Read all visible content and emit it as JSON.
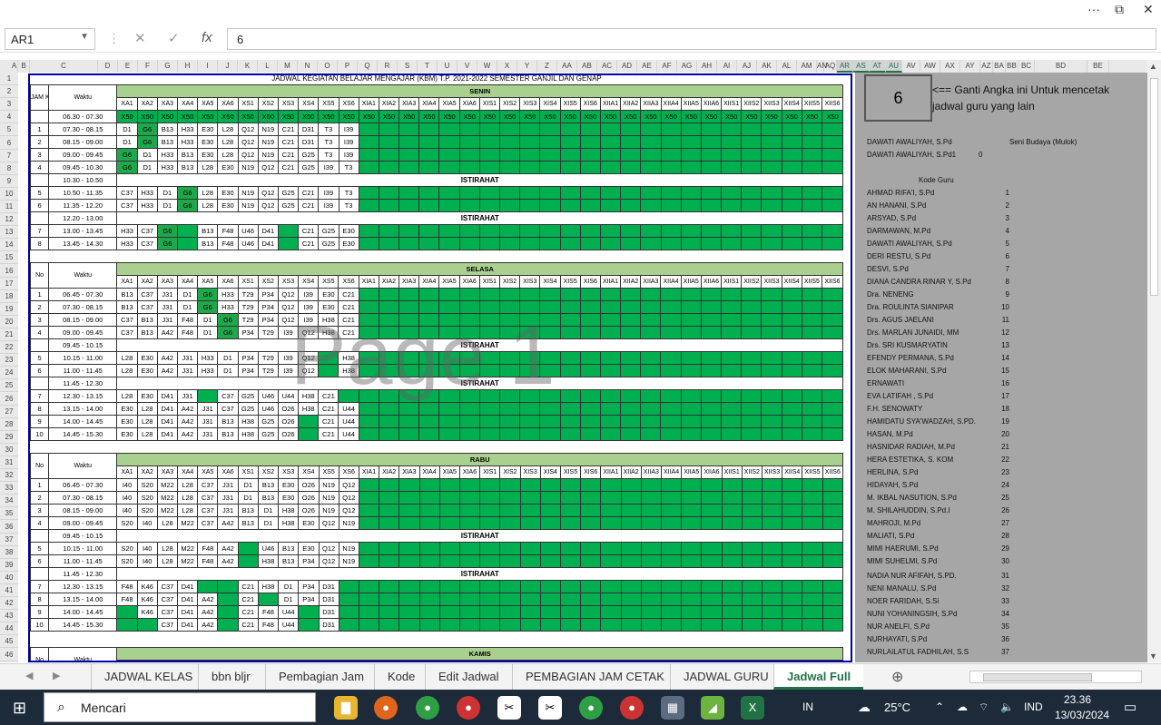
{
  "window": {
    "ribbon_dots": "···",
    "restore": "⧉",
    "close": "✕"
  },
  "formula_bar": {
    "name_box": "AR1",
    "cancel": "✕",
    "enter": "✓",
    "fx": "fx",
    "value": "6"
  },
  "columns": [
    "A",
    "B",
    "C",
    "D",
    "E",
    "F",
    "G",
    "H",
    "I",
    "J",
    "K",
    "L",
    "M",
    "N",
    "O",
    "P",
    "Q",
    "R",
    "S",
    "T",
    "U",
    "V",
    "W",
    "X",
    "Y",
    "Z",
    "AA",
    "AB",
    "AC",
    "AD",
    "AE",
    "AF",
    "AG",
    "AH",
    "AI",
    "AJ",
    "AK",
    "AL",
    "AM",
    "AN",
    "AQ",
    "AR",
    "AS",
    "AT",
    "AU",
    "AV",
    "AW",
    "AX",
    "AY",
    "AZ",
    "BA",
    "BB",
    "BC",
    "BD",
    "BE"
  ],
  "selected_columns": [
    "AR",
    "AS",
    "AT",
    "AU"
  ],
  "rows": [
    "1",
    "2",
    "3",
    "4",
    "5",
    "6",
    "7",
    "8",
    "9",
    "10",
    "11",
    "12",
    "13",
    "14",
    "15",
    "16",
    "17",
    "18",
    "19",
    "20",
    "21",
    "22",
    "23",
    "24",
    "25",
    "26",
    "27",
    "28",
    "29",
    "30",
    "31",
    "32",
    "33",
    "34",
    "35",
    "36",
    "37",
    "38",
    "39",
    "40",
    "41",
    "42",
    "43",
    "44",
    "45",
    "46"
  ],
  "sheet_title": "JADWAL KEGIATAN BELAJAR MENGAJAR (KBM) T.P. 2021-2022 SEMESTER GANJIL DAN GENAP",
  "hdr": {
    "jam_ke": "JAM KE",
    "no": "No",
    "waktu": "Waktu"
  },
  "class_cols": [
    "XA1",
    "XA2",
    "XA3",
    "XA4",
    "XA5",
    "XA6",
    "XS1",
    "XS2",
    "XS3",
    "XS4",
    "XS5",
    "XS6",
    "XIA1",
    "XIA2",
    "XIA3",
    "XIA4",
    "XIA5",
    "XIA6",
    "XIS1",
    "XIS2",
    "XIS3",
    "XIS4",
    "XIS5",
    "XIS6",
    "XIIA1",
    "XIIA2",
    "XIIA3",
    "XIIA4",
    "XIIA5",
    "XIIA6",
    "XIIS1",
    "XIIS2",
    "XIIS3",
    "XIIS4",
    "XIIS5",
    "XIIS6"
  ],
  "days": {
    "senin": {
      "name": "SENIN",
      "rows": [
        {
          "no": "",
          "time": "06.30 - 07.30",
          "cells": [
            "X50",
            "X50",
            "X50",
            "X50",
            "X50",
            "X50",
            "X50",
            "X50",
            "X50",
            "X50",
            "X50",
            "X50",
            "X50",
            "X50",
            "X50",
            "X50",
            "X50",
            "X50",
            "X50",
            "X50",
            "X50",
            "X50",
            "X50",
            "X50",
            "X50",
            "X50",
            "X50",
            "X50",
            "X50",
            "X50",
            "X50",
            "X50",
            "X50",
            "X50",
            "X50",
            "X50"
          ],
          "allgreen": true
        },
        {
          "no": "1",
          "time": "07.30 - 08.15",
          "cells": [
            "D1",
            "G6",
            "B13",
            "H33",
            "E30",
            "L28",
            "Q12",
            "N19",
            "C21",
            "D31",
            "T3",
            "I39"
          ]
        },
        {
          "no": "2",
          "time": "08.15 - 09.00",
          "cells": [
            "D1",
            "G6",
            "B13",
            "H33",
            "E30",
            "L28",
            "Q12",
            "N19",
            "C21",
            "D31",
            "T3",
            "I39"
          ]
        },
        {
          "no": "3",
          "time": "09.00 - 09.45",
          "cells": [
            "G6",
            "D1",
            "H33",
            "B13",
            "E30",
            "L28",
            "Q12",
            "N19",
            "C21",
            "G25",
            "T3",
            "I39"
          ]
        },
        {
          "no": "4",
          "time": "09.45 - 10.30",
          "cells": [
            "G6",
            "D1",
            "H33",
            "B13",
            "L28",
            "E30",
            "N19",
            "Q12",
            "C21",
            "G25",
            "I39",
            "T3"
          ]
        },
        {
          "ist": "ISTIRAHAT",
          "time": "10.30 - 10.50"
        },
        {
          "no": "5",
          "time": "10.50 - 11.35",
          "cells": [
            "C37",
            "H33",
            "D1",
            "G6",
            "L28",
            "E30",
            "N19",
            "Q12",
            "G25",
            "C21",
            "I39",
            "T3"
          ]
        },
        {
          "no": "6",
          "time": "11.35 - 12.20",
          "cells": [
            "C37",
            "H33",
            "D1",
            "G6",
            "L28",
            "E30",
            "N19",
            "Q12",
            "G25",
            "C21",
            "I39",
            "T3"
          ]
        },
        {
          "ist": "ISTIRAHAT",
          "time": "12.20 - 13.00"
        },
        {
          "no": "7",
          "time": "13.00 - 13.45",
          "cells": [
            "H33",
            "C37",
            "G6",
            "",
            "B13",
            "F48",
            "U46",
            "D41",
            "",
            "C21",
            "G25",
            "E30"
          ]
        },
        {
          "no": "8",
          "time": "13.45 - 14.30",
          "cells": [
            "H33",
            "C37",
            "G6",
            "",
            "B13",
            "F48",
            "U46",
            "D41",
            "",
            "C21",
            "G25",
            "E30"
          ]
        }
      ]
    },
    "selasa": {
      "name": "SELASA",
      "rows": [
        {
          "no": "1",
          "time": "06.45 - 07.30",
          "cells": [
            "B13",
            "C37",
            "J31",
            "D1",
            "G6",
            "H33",
            "T29",
            "P34",
            "Q12",
            "I39",
            "E30",
            "C21"
          ]
        },
        {
          "no": "2",
          "time": "07.30 - 08.15",
          "cells": [
            "B13",
            "C37",
            "J31",
            "D1",
            "G6",
            "H33",
            "T29",
            "P34",
            "Q12",
            "I39",
            "E30",
            "C21"
          ]
        },
        {
          "no": "3",
          "time": "08.15 - 09.00",
          "cells": [
            "C37",
            "B13",
            "J31",
            "F48",
            "D1",
            "G6",
            "T29",
            "P34",
            "Q12",
            "I39",
            "H38",
            "C21"
          ]
        },
        {
          "no": "4",
          "time": "09.00 - 09.45",
          "cells": [
            "C37",
            "B13",
            "A42",
            "F48",
            "D1",
            "G6",
            "P34",
            "T29",
            "I39",
            "Q12",
            "H38",
            "C21"
          ]
        },
        {
          "ist": "ISTIRAHAT",
          "time": "09.45 - 10.15"
        },
        {
          "no": "5",
          "time": "10.15 - 11.00",
          "cells": [
            "L28",
            "E30",
            "A42",
            "J31",
            "H33",
            "D1",
            "P34",
            "T29",
            "I39",
            "Q12",
            "",
            "H38"
          ]
        },
        {
          "no": "6",
          "time": "11.00 - 11.45",
          "cells": [
            "L28",
            "E30",
            "A42",
            "J31",
            "H33",
            "D1",
            "P34",
            "T29",
            "I39",
            "Q12",
            "",
            "H38"
          ]
        },
        {
          "ist": "ISTIRAHAT",
          "time": "11.45 - 12.30"
        },
        {
          "no": "7",
          "time": "12.30 - 13.15",
          "cells": [
            "L28",
            "E30",
            "D41",
            "J31",
            "",
            "C37",
            "G25",
            "U46",
            "U44",
            "H38",
            "C21",
            ""
          ]
        },
        {
          "no": "8",
          "time": "13.15 - 14.00",
          "cells": [
            "E30",
            "L28",
            "D41",
            "A42",
            "J31",
            "C37",
            "G25",
            "U46",
            "O26",
            "H38",
            "C21",
            "U44"
          ]
        },
        {
          "no": "9",
          "time": "14.00 - 14.45",
          "cells": [
            "E30",
            "L28",
            "D41",
            "A42",
            "J31",
            "B13",
            "H38",
            "G25",
            "O26",
            "",
            "C21",
            "U44"
          ]
        },
        {
          "no": "10",
          "time": "14.45 - 15.30",
          "cells": [
            "E30",
            "L28",
            "D41",
            "A42",
            "J31",
            "B13",
            "H38",
            "G25",
            "O26",
            "",
            "C21",
            "U44"
          ]
        }
      ]
    },
    "rabu": {
      "name": "RABU",
      "rows": [
        {
          "no": "1",
          "time": "06.45 - 07.30",
          "cells": [
            "I40",
            "S20",
            "M22",
            "L28",
            "C37",
            "J31",
            "D1",
            "B13",
            "E30",
            "O26",
            "N19",
            "Q12"
          ]
        },
        {
          "no": "2",
          "time": "07.30 - 08.15",
          "cells": [
            "I40",
            "S20",
            "M22",
            "L28",
            "C37",
            "J31",
            "D1",
            "B13",
            "E30",
            "O26",
            "N19",
            "Q12"
          ]
        },
        {
          "no": "3",
          "time": "08.15 - 09.00",
          "cells": [
            "I40",
            "S20",
            "M22",
            "L28",
            "C37",
            "J31",
            "B13",
            "D1",
            "H38",
            "O26",
            "N19",
            "Q12"
          ]
        },
        {
          "no": "4",
          "time": "09.00 - 09.45",
          "cells": [
            "S20",
            "I40",
            "L28",
            "M22",
            "C37",
            "A42",
            "B13",
            "D1",
            "H38",
            "E30",
            "Q12",
            "N19"
          ]
        },
        {
          "ist": "ISTIRAHAT",
          "time": "09.45 - 10.15"
        },
        {
          "no": "5",
          "time": "10.15 - 11.00",
          "cells": [
            "S20",
            "I40",
            "L28",
            "M22",
            "F48",
            "A42",
            "",
            "U46",
            "B13",
            "E30",
            "Q12",
            "N19"
          ]
        },
        {
          "no": "6",
          "time": "11.00 - 11.45",
          "cells": [
            "S20",
            "I40",
            "L28",
            "M22",
            "F48",
            "A42",
            "",
            "H38",
            "B13",
            "P34",
            "Q12",
            "N19"
          ]
        },
        {
          "ist": "ISTIRAHAT",
          "time": "11.45 - 12.30"
        },
        {
          "no": "7",
          "time": "12.30 - 13.15",
          "cells": [
            "F48",
            "K46",
            "C37",
            "D41",
            "",
            "",
            "C21",
            "H38",
            "D1",
            "P34",
            "D31",
            ""
          ]
        },
        {
          "no": "8",
          "time": "13.15 - 14.00",
          "cells": [
            "F48",
            "K46",
            "C37",
            "D41",
            "A42",
            "",
            "C21",
            "",
            "D1",
            "P34",
            "D31",
            ""
          ]
        },
        {
          "no": "9",
          "time": "14.00 - 14.45",
          "cells": [
            "",
            "K46",
            "C37",
            "D41",
            "A42",
            "",
            "C21",
            "F48",
            "U44",
            "",
            "D31",
            ""
          ]
        },
        {
          "no": "10",
          "time": "14.45 - 15.30",
          "cells": [
            "",
            "",
            "C37",
            "D41",
            "A42",
            "",
            "C21",
            "F48",
            "U44",
            "",
            "D31",
            ""
          ]
        }
      ]
    },
    "kamis": {
      "name": "KAMIS"
    }
  },
  "watermark": "Page 1",
  "right_panel": {
    "value": "6",
    "note": "<== Ganti Angka ini Untuk mencetak jadwal guru yang lain",
    "teacher_line1": "DAWATI AWALIYAH, S.Pd",
    "teacher_subject": "Seni Budaya (Mulok)",
    "teacher_line2": "DAWATI AWALIYAH, S.Pd1",
    "teacher_zero": "0",
    "kode_guru": "Kode Guru",
    "teachers": [
      [
        "AHMAD RIFA'I, S.Pd",
        "1"
      ],
      [
        "AN HANANI, S.Pd",
        "2"
      ],
      [
        "ARSYAD, S.Pd",
        "3"
      ],
      [
        "DARMAWAN, M.Pd",
        "4"
      ],
      [
        "DAWATI AWALIYAH, S.Pd",
        "5"
      ],
      [
        "DERI RESTU, S.Pd",
        "6"
      ],
      [
        "DESVI, S.Pd",
        "7"
      ],
      [
        "DIANA CANDRA RINAR Y, S.Pd",
        "8"
      ],
      [
        "Dra. NENENG",
        "9"
      ],
      [
        "Dra. ROULINTA SIANIPAR",
        "10"
      ],
      [
        "Drs. AGUS JAELANI",
        "11"
      ],
      [
        "Drs. MARLAN JUNAIDI, MM",
        "12"
      ],
      [
        "Drs. SRI KUSMARYATIN",
        "13"
      ],
      [
        "EFENDY PERMANA, S.Pd",
        "14"
      ],
      [
        "ELOK MAHARANI, S.Pd",
        "15"
      ],
      [
        "ERNAWATI",
        "16"
      ],
      [
        "EVA LATIFAH , S.Pd",
        "17"
      ],
      [
        "F.H. SENOWATY",
        "18"
      ],
      [
        "HAMIDATU SYA'WADZAH, S.PD.",
        "19"
      ],
      [
        "HASAN, M.Pd",
        "20"
      ],
      [
        "HASNIDAR RADIAH, M.Pd",
        "21"
      ],
      [
        "HERA ESTETIKA, S. KOM",
        "22"
      ],
      [
        "HERLINA, S.Pd",
        "23"
      ],
      [
        "HIDAYAH, S.Pd",
        "24"
      ],
      [
        "M. IKBAL NASUTION, S.Pd",
        "25"
      ],
      [
        "M. SHILAHUDDIN, S.Pd.I",
        "26"
      ],
      [
        "MAHROJI, M.Pd",
        "27"
      ],
      [
        "MALIATI, S.Pd",
        "28"
      ],
      [
        "MIMI HAERUMI, S.Pd",
        "29"
      ],
      [
        "MIMI SUHELMI, S.Pd",
        "30"
      ],
      [
        "NADIA NUR AFIFAH, S.PD.",
        "31"
      ],
      [
        "NENI MANALU, S.Pd",
        "32"
      ],
      [
        "NOER FARIDAH, S.Si",
        "33"
      ],
      [
        "NUNI YOHANINGSIH, S.Pd",
        "34"
      ],
      [
        "NUR ANELFI, S.Pd",
        "35"
      ],
      [
        "NURHAYATI, S.Pd",
        "36"
      ],
      [
        "NURLAILATUL FADHILAH, S.S",
        "37"
      ]
    ]
  },
  "sheet_tabs": [
    "JADWAL KELAS",
    "bbn bljr",
    "Pembagian Jam",
    "Kode",
    "Edit Jadwal",
    "PEMBAGIAN JAM CETAK",
    "JADWAL GURU",
    "Jadwal Full"
  ],
  "active_tab": "Jadwal Full",
  "taskbar": {
    "search": "Mencari",
    "lang": "IN",
    "temp": "25°C",
    "kbd": "IND",
    "time": "23.36",
    "date": "13/03/2024"
  }
}
